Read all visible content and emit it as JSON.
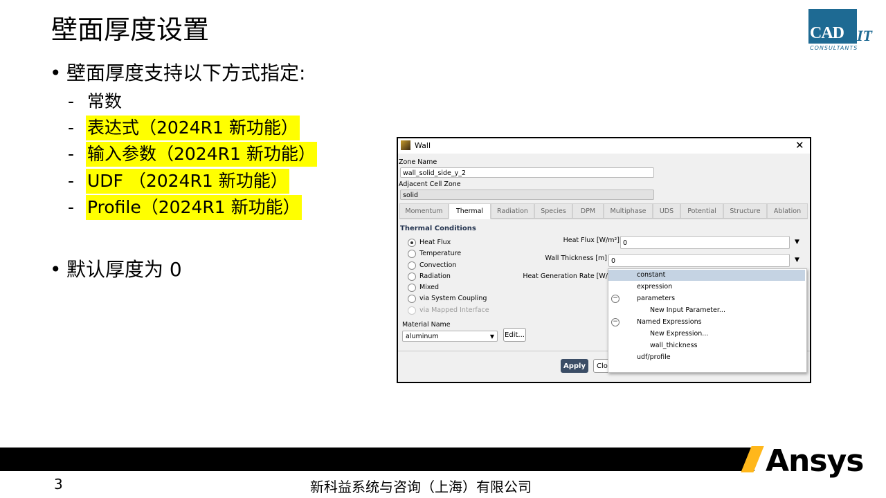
{
  "slide": {
    "title": "壁面厚度设置",
    "bullet1": "壁面厚度支持以下方式指定:",
    "items": [
      {
        "dash": "-",
        "text": "常数"
      },
      {
        "dash": "-",
        "text": "表达式（2024R1 新功能）"
      },
      {
        "dash": "-",
        "text": "输入参数（2024R1 新功能）"
      },
      {
        "dash": "-",
        "text": "UDF （2024R1 新功能）"
      },
      {
        "dash": "-",
        "text": "Profile（2024R1 新功能）"
      }
    ],
    "bullet2": "默认厚度为 0",
    "bullet_char": "•"
  },
  "logo": {
    "main": "CAD",
    "it": "IT",
    "sub": "CONSULTANTS",
    "color": "#1e6a93"
  },
  "footer": {
    "page": "3",
    "company": "新科益系统与咨询（上海）有限公司",
    "brand": "Ansys",
    "accent": "#ffb71b"
  },
  "dialog": {
    "title": "Wall",
    "close": "✕",
    "zone_name_label": "Zone Name",
    "zone_name_value": "wall_solid_side_y_2",
    "adjacent_label": "Adjacent Cell Zone",
    "adjacent_value": "solid",
    "tabs": [
      "Momentum",
      "Thermal",
      "Radiation",
      "Species",
      "DPM",
      "Multiphase",
      "UDS",
      "Potential",
      "Structure",
      "Ablation"
    ],
    "active_tab": "Thermal",
    "section": "Thermal Conditions",
    "radios": [
      {
        "label": "Heat Flux",
        "checked": true,
        "disabled": false
      },
      {
        "label": "Temperature",
        "checked": false,
        "disabled": false
      },
      {
        "label": "Convection",
        "checked": false,
        "disabled": false
      },
      {
        "label": "Radiation",
        "checked": false,
        "disabled": false
      },
      {
        "label": "Mixed",
        "checked": false,
        "disabled": false
      },
      {
        "label": "via System Coupling",
        "checked": false,
        "disabled": false
      },
      {
        "label": "via Mapped Interface",
        "checked": false,
        "disabled": true
      }
    ],
    "heat_flux_label": "Heat Flux [W/m²]",
    "heat_flux_value": "0",
    "wall_thickness_label": "Wall Thickness [m]",
    "wall_thickness_value": "0",
    "heat_gen_label": "Heat Generation Rate [W/",
    "material_label": "Material Name",
    "material_value": "aluminum",
    "edit_button": "Edit...",
    "apply_button": "Apply",
    "close_button": "Clo",
    "dropdown": [
      {
        "label": "constant",
        "selected": true,
        "toggle": false,
        "indent": 0
      },
      {
        "label": "expression",
        "selected": false,
        "toggle": false,
        "indent": 0
      },
      {
        "label": "parameters",
        "selected": false,
        "toggle": true,
        "indent": 0
      },
      {
        "label": "New Input Parameter...",
        "selected": false,
        "toggle": false,
        "indent": 1
      },
      {
        "label": "Named Expressions",
        "selected": false,
        "toggle": true,
        "indent": 0
      },
      {
        "label": "New Expression...",
        "selected": false,
        "toggle": false,
        "indent": 1
      },
      {
        "label": "wall_thickness",
        "selected": false,
        "toggle": false,
        "indent": 1
      },
      {
        "label": "udf/profile",
        "selected": false,
        "toggle": false,
        "indent": 0
      }
    ]
  }
}
